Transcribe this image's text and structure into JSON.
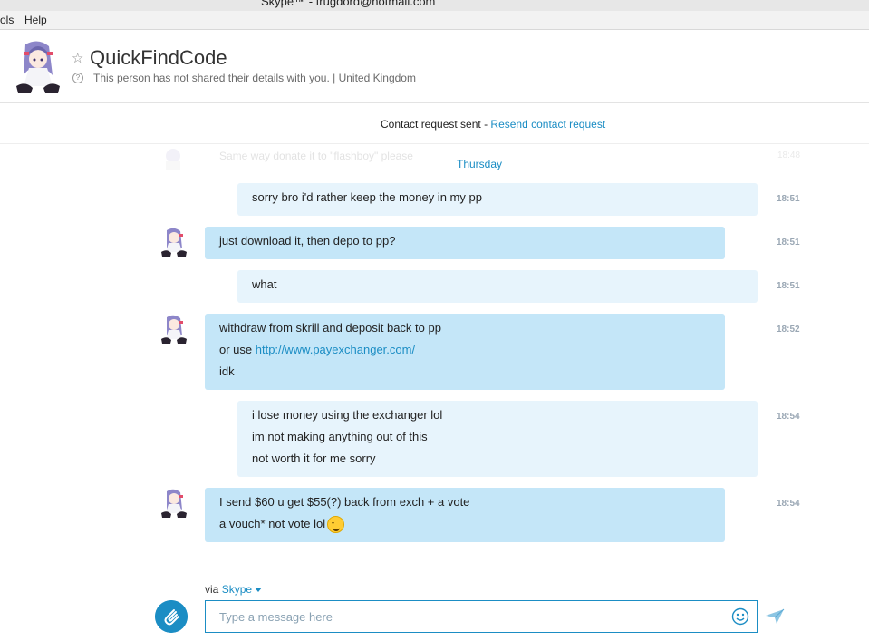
{
  "window": {
    "title": "Skype™ - frugdord@hotmail.com"
  },
  "menu": {
    "items": [
      {
        "label": "ols"
      },
      {
        "label": "Help"
      }
    ]
  },
  "header": {
    "contact_name": "QuickFindCode",
    "status": "This person has not shared their details with you.  |  United Kingdom"
  },
  "request": {
    "text": "Contact request sent - ",
    "link": "Resend contact request"
  },
  "chat": {
    "faded": {
      "text": "Same way donate it to \"flashboy\" please",
      "time": "18:48"
    },
    "day_label": "Thursday",
    "messages": [
      {
        "direction": "out",
        "lines": [
          "sorry bro i'd rather keep the money in my pp"
        ],
        "time": "18:51"
      },
      {
        "direction": "in",
        "lines": [
          "just download it, then depo to pp?"
        ],
        "time": "18:51"
      },
      {
        "direction": "out",
        "lines": [
          "what"
        ],
        "time": "18:51"
      },
      {
        "direction": "in",
        "lines": [
          "withdraw from skrill and deposit back to pp",
          "or use ",
          "idk"
        ],
        "link": "http://www.payexchanger.com/",
        "time": "18:52"
      },
      {
        "direction": "out",
        "lines": [
          "i lose money using the exchanger lol",
          "im not making anything out of this",
          "not worth it for me sorry"
        ],
        "time": "18:54"
      },
      {
        "direction": "in",
        "lines": [
          "I send $60 u get $55(?) back from exch + a vote",
          "a vouch* not vote lol"
        ],
        "emoji": "grin-emoji",
        "time": "18:54"
      }
    ]
  },
  "composer": {
    "via_label": "via ",
    "via_service": "Skype",
    "placeholder": "Type a message here"
  },
  "colors": {
    "accent": "#1b8dc4",
    "bubble_out": "#e7f4fc",
    "bubble_in": "#c4e6f8"
  },
  "icons": {
    "favorite": "star-icon",
    "info": "info-icon",
    "attach": "paperclip-icon",
    "emoticon": "smiley-icon",
    "send": "paper-plane-icon"
  }
}
